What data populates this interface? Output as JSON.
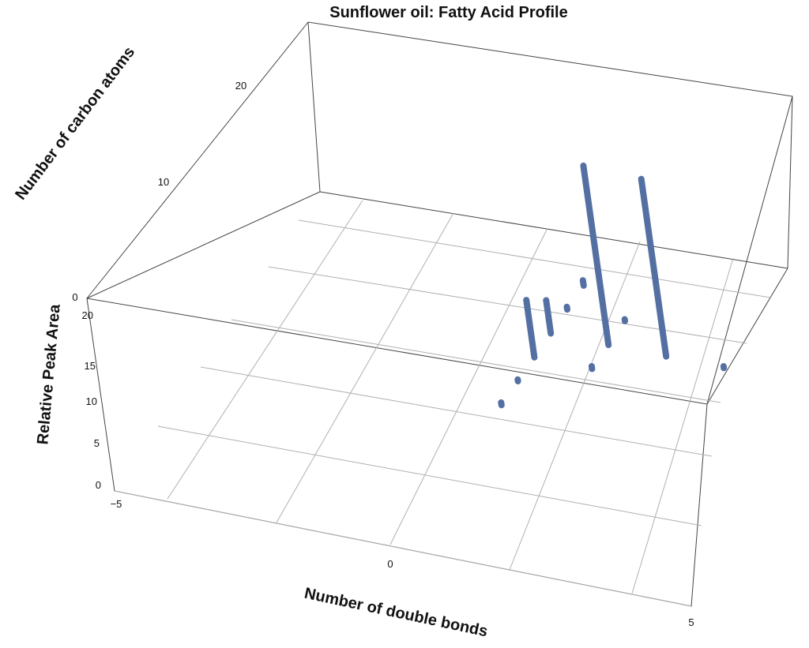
{
  "chart_data": {
    "type": "bar3d",
    "title": "Sunflower oil: Fatty Acid Profile",
    "xlabel": "Number of double bonds",
    "ylabel": "Number of carbon atoms",
    "zlabel": "Relative Peak Area",
    "xlim": [
      -5,
      5
    ],
    "ylim": [
      0,
      25
    ],
    "zlim": [
      0,
      22
    ],
    "x_ticks": [
      -5,
      0,
      5
    ],
    "y_ticks": [
      0,
      10,
      20
    ],
    "z_ticks": [
      0,
      5,
      10,
      15,
      20
    ],
    "color": "#5470a3",
    "points": [
      {
        "x": 0,
        "y": 12,
        "z": 0.3
      },
      {
        "x": 0,
        "y": 14,
        "z": 0.2
      },
      {
        "x": 0,
        "y": 16,
        "z": 6.4
      },
      {
        "x": 1,
        "y": 16,
        "z": 0.3
      },
      {
        "x": 0,
        "y": 18,
        "z": 3.7
      },
      {
        "x": 1,
        "y": 18,
        "z": 20.0
      },
      {
        "x": 2,
        "y": 18,
        "z": 19.8
      },
      {
        "x": 3,
        "y": 18,
        "z": 0.2
      },
      {
        "x": 0,
        "y": 20,
        "z": 0.3
      },
      {
        "x": 1,
        "y": 20,
        "z": 0.2
      },
      {
        "x": 0,
        "y": 22,
        "z": 0.6
      },
      {
        "x": 5,
        "y": 22,
        "z": 0.9
      }
    ]
  }
}
